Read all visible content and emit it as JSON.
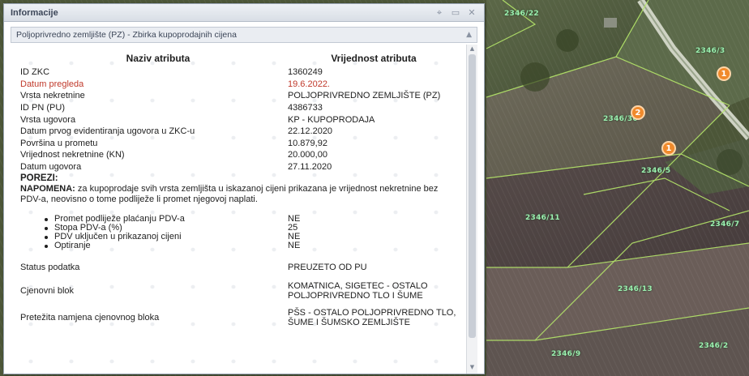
{
  "panel": {
    "title": "Informacije",
    "buttons": {
      "pin": "⌖",
      "restore": "▭",
      "close": "✕"
    }
  },
  "layer": {
    "title": "Poljoprivredno zemljište (PZ) - Zbirka kupoprodajnih cijena",
    "collapse": "▲"
  },
  "table": {
    "header_name": "Naziv atributa",
    "header_value": "Vrijednost atributa",
    "rows": [
      {
        "label": "ID ZKC",
        "value": "1360249"
      },
      {
        "label": "Datum pregleda",
        "value": "19.6.2022."
      },
      {
        "label": "Vrsta nekretnine",
        "value": "POLJOPRIVREDNO ZEMLJIŠTE (PZ)"
      },
      {
        "label": "ID PN (PU)",
        "value": "4386733"
      },
      {
        "label": "Vrsta ugovora",
        "value": "KP - KUPOPRODAJA"
      },
      {
        "label": "Datum prvog evidentiranja ugovora u ZKC-u",
        "value": "22.12.2020"
      },
      {
        "label": "Površina u prometu",
        "value": "10.879,92"
      },
      {
        "label": "Vrijednost nekretnine (KN)",
        "value": "20.000,00"
      },
      {
        "label": "Datum ugovora",
        "value": "27.11.2020"
      }
    ]
  },
  "taxes": {
    "heading": "POREZI:",
    "note_label": "NAPOMENA:",
    "note_text": " za kupoprodaje svih vrsta zemljišta u iskazanoj cijeni prikazana je vrijednost nekretnine bez PDV-a, neovisno o tome podliježe li promet njegovoj naplati.",
    "items": [
      {
        "label": "Promet podliježe plaćanju PDV-a",
        "value": "NE"
      },
      {
        "label": "Stopa PDV-a (%)",
        "value": "25"
      },
      {
        "label": "PDV uključen u prikazanoj cijeni",
        "value": "NE"
      },
      {
        "label": "Optiranje",
        "value": "NE"
      }
    ]
  },
  "extra": {
    "status_label": "Status podatka",
    "status_value": "PREUZETO OD PU",
    "block_label": "Cjenovni blok",
    "block_value": "KOMATNICA, SIGETEC - OSTALO POLJOPRIVREDNO TLO I ŠUME",
    "purpose_label": "Pretežita namjena cjenovnog bloka",
    "purpose_value": "PŠS - OSTALO POLJOPRIVREDNO TLO, ŠUME I ŠUMSKO ZEMLJIŠTE"
  },
  "map": {
    "markers": [
      "1",
      "2",
      "1"
    ]
  },
  "colors": {
    "accent_orange": "#f08a2c",
    "parcel_line": "#b6e86a",
    "date_red": "#c0392b"
  }
}
